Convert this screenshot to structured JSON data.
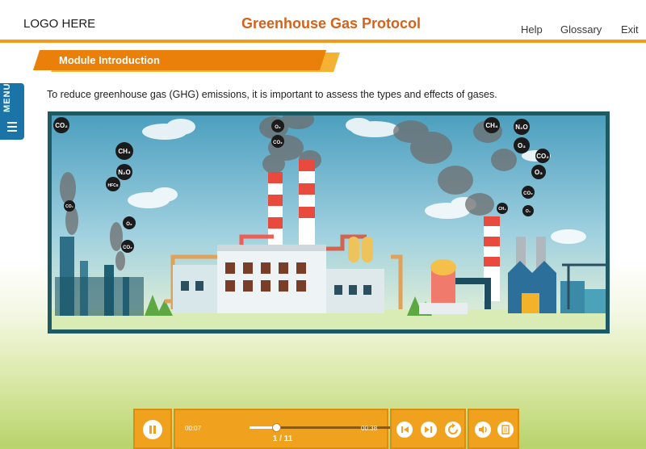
{
  "header": {
    "logo": "LOGO HERE",
    "title": "Greenhouse Gas Protocol",
    "nav": {
      "help": "Help",
      "glossary": "Glossary",
      "exit": "Exit"
    }
  },
  "menu": {
    "label": "MENU"
  },
  "module": {
    "banner": "Module Introduction",
    "intro": "To reduce greenhouse gas (GHG) emissions, it is important to assess the types and effects of gases."
  },
  "illustration": {
    "molecules": [
      "CO₂",
      "CH₄",
      "N₂O",
      "HFCs",
      "O₃",
      "CO₂",
      "CO₂",
      "O₃",
      "CH₄",
      "N₂O",
      "O₃",
      "CO₂",
      "O₃",
      "CO₂",
      "CH₄",
      "O₃",
      "CO₂"
    ]
  },
  "player": {
    "time_elapsed": "00:07",
    "time_total": "00:38",
    "progress": 0.18,
    "counter": "1 / 11"
  },
  "colors": {
    "accent": "#ea8009",
    "title": "#d5621a",
    "menu": "#1a74a8",
    "frame": "#1d5a63"
  }
}
